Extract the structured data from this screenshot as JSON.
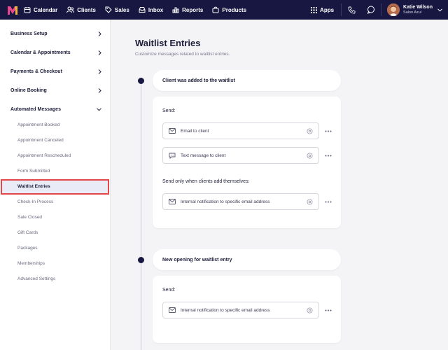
{
  "topnav": {
    "items": [
      {
        "label": "Calendar",
        "icon": "calendar-icon"
      },
      {
        "label": "Clients",
        "icon": "clients-icon"
      },
      {
        "label": "Sales",
        "icon": "tag-icon"
      },
      {
        "label": "Inbox",
        "icon": "inbox-icon"
      },
      {
        "label": "Reports",
        "icon": "bar-chart-icon"
      },
      {
        "label": "Products",
        "icon": "bag-icon"
      }
    ],
    "apps_label": "Apps",
    "user_name": "Katie Wilson",
    "user_business": "Salon Azul"
  },
  "sidebar": {
    "sections": [
      {
        "label": "Business Setup"
      },
      {
        "label": "Calendar & Appointments"
      },
      {
        "label": "Payments & Checkout"
      },
      {
        "label": "Online Booking"
      },
      {
        "label": "Automated Messages"
      }
    ],
    "sub_items": [
      "Appointment Booked",
      "Appointment Canceled",
      "Appointment Rescheduled",
      "Form Submitted",
      "Waitlist Entries",
      "Check-In Process",
      "Sale Closed",
      "Gift Cards",
      "Packages",
      "Memberships",
      "Advanced Settings"
    ],
    "active_item": "Waitlist Entries"
  },
  "main": {
    "title": "Waitlist Entries",
    "subtitle": "Customize messages related to waitlist entries.",
    "groups": [
      {
        "heading": "Client was added to the waitlist",
        "send_label": "Send:",
        "fields": [
          "Email to client",
          "Text message to client"
        ],
        "conditional_label": "Send only when clients add themselves:",
        "conditional_fields": [
          "Internal notification to specific email address"
        ]
      },
      {
        "heading": "New opening for waitlist entry",
        "send_label": "Send:",
        "fields": [
          "Internal notification to specific email address"
        ]
      }
    ]
  },
  "colors": {
    "nav_bg": "#171742",
    "active_highlight": "#e4474a",
    "page_bg": "#f4f4f6"
  }
}
